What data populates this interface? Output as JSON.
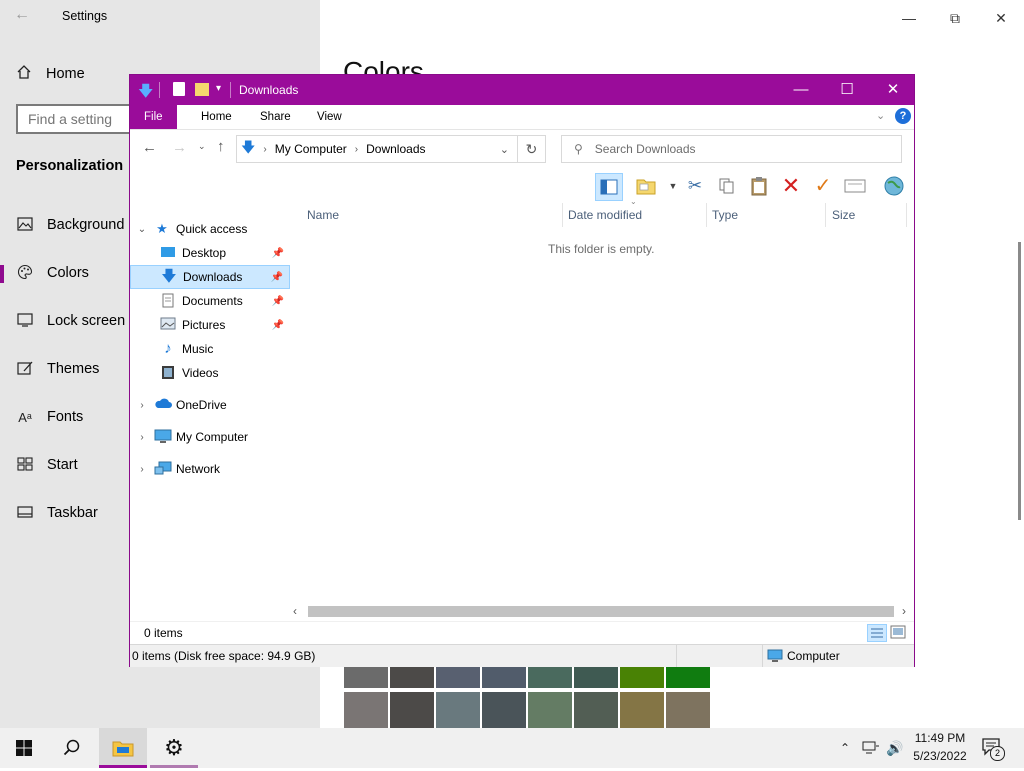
{
  "settings": {
    "title": "Settings",
    "home": "Home",
    "search_placeholder": "Find a setting",
    "section": "Personalization",
    "heading": "Colors",
    "nav": [
      {
        "label": "Background",
        "icon": "picture-icon"
      },
      {
        "label": "Colors",
        "icon": "palette-icon"
      },
      {
        "label": "Lock screen",
        "icon": "lock-screen-icon"
      },
      {
        "label": "Themes",
        "icon": "themes-icon"
      },
      {
        "label": "Fonts",
        "icon": "fonts-icon"
      },
      {
        "label": "Start",
        "icon": "start-icon"
      },
      {
        "label": "Taskbar",
        "icon": "taskbar-icon"
      }
    ],
    "selected": "Colors",
    "accent": "#8f0a8f"
  },
  "explorer": {
    "title": "Downloads",
    "accent": "#9a0c9a",
    "tabs": [
      "File",
      "Home",
      "Share",
      "View"
    ],
    "breadcrumb": [
      "My Computer",
      "Downloads"
    ],
    "search_placeholder": "Search Downloads",
    "nav": {
      "quick_access": "Quick access",
      "items": [
        {
          "label": "Desktop",
          "pinned": true
        },
        {
          "label": "Downloads",
          "pinned": true
        },
        {
          "label": "Documents",
          "pinned": true
        },
        {
          "label": "Pictures",
          "pinned": true
        },
        {
          "label": "Music",
          "pinned": false
        },
        {
          "label": "Videos",
          "pinned": false
        }
      ],
      "roots": [
        "OneDrive",
        "My Computer",
        "Network"
      ]
    },
    "columns": [
      "Name",
      "Date modified",
      "Type",
      "Size"
    ],
    "empty_message": "This folder is empty.",
    "item_count": "0 items",
    "status": "0 items (Disk free space: 94.9 GB)",
    "status_location": "Computer"
  },
  "taskbar": {
    "time": "11:49 PM",
    "date": "5/23/2022",
    "notifications": "2"
  }
}
